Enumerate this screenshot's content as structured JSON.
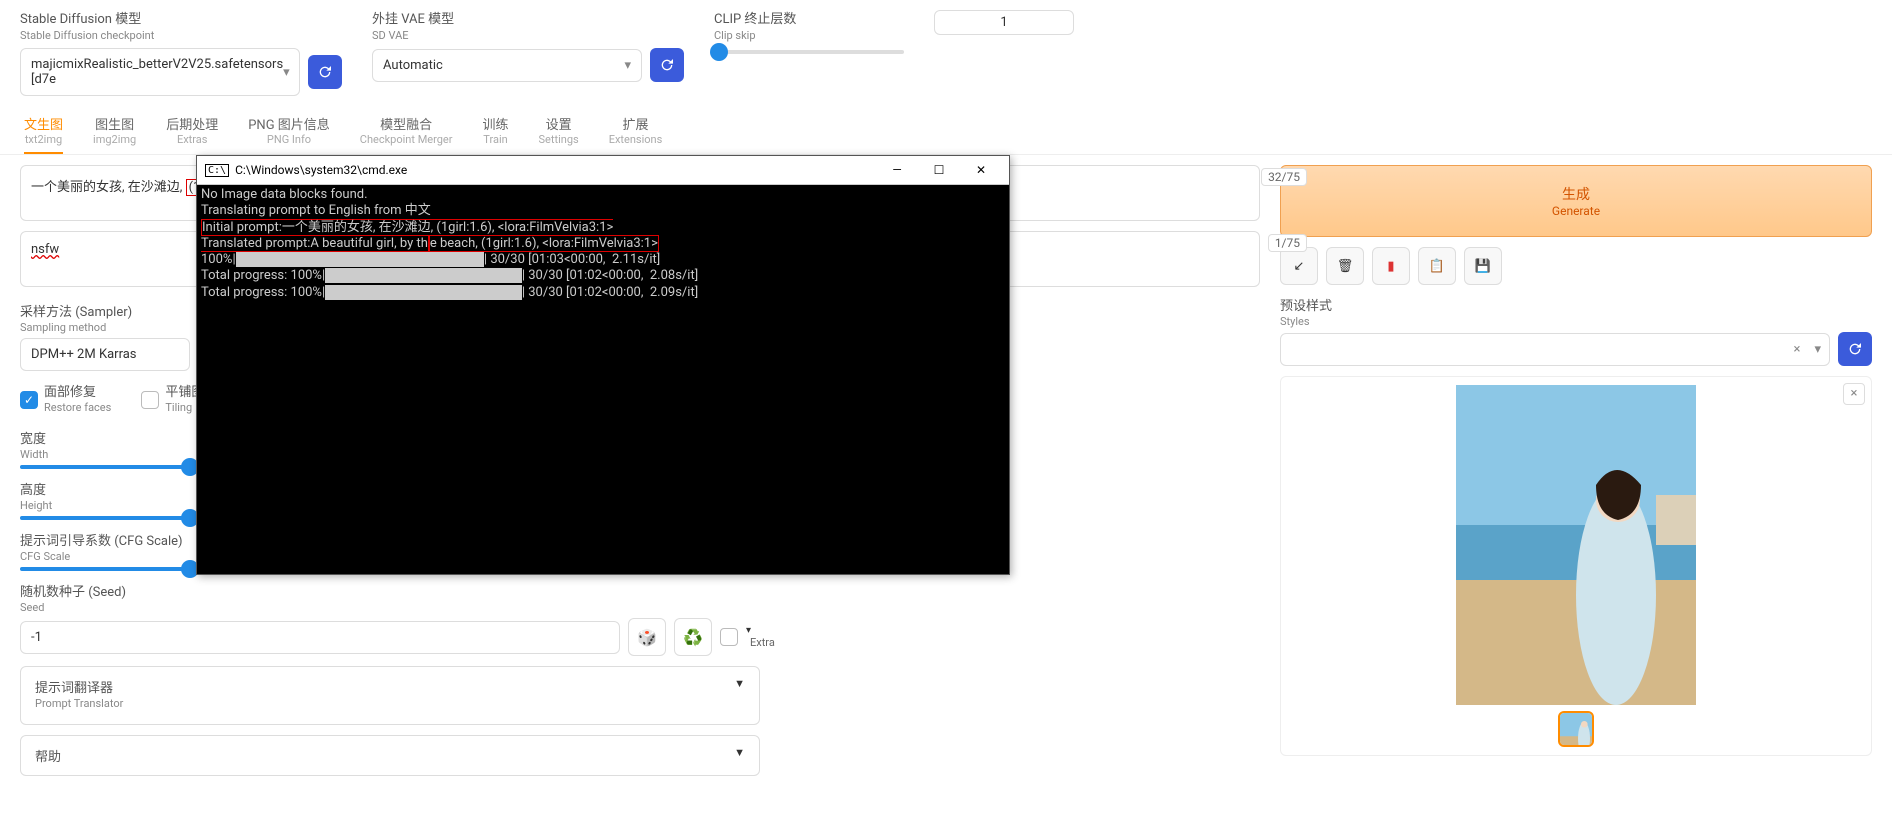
{
  "top": {
    "sd_checkpoint_cn": "Stable Diffusion 模型",
    "sd_checkpoint_en": "Stable Diffusion checkpoint",
    "sd_value": "majicmixRealistic_betterV2V25.safetensors [d7e",
    "vae_cn": "外挂 VAE 模型",
    "vae_en": "SD VAE",
    "vae_value": "Automatic",
    "clip_cn": "CLIP 终止层数",
    "clip_en": "Clip skip",
    "clip_value": "1"
  },
  "tabs": [
    {
      "cn": "文生图",
      "en": "txt2img"
    },
    {
      "cn": "图生图",
      "en": "img2img"
    },
    {
      "cn": "后期处理",
      "en": "Extras"
    },
    {
      "cn": "PNG 图片信息",
      "en": "PNG Info"
    },
    {
      "cn": "模型融合",
      "en": "Checkpoint Merger"
    },
    {
      "cn": "训练",
      "en": "Train"
    },
    {
      "cn": "设置",
      "en": "Settings"
    },
    {
      "cn": "扩展",
      "en": "Extensions"
    }
  ],
  "prompt": {
    "prefix": "一个美丽的女孩, 在沙滩边,",
    "highlight": "(1girl:1.6), <lora:FilmVelvia3:1>",
    "token": "32/75"
  },
  "neg": {
    "text": "nsfw",
    "token": "1/75"
  },
  "params": {
    "sampler_cn": "采样方法 (Sampler)",
    "sampler_en": "Sampling method",
    "sampler_value": "DPM++ 2M Karras",
    "restore_cn": "面部修复",
    "restore_en": "Restore faces",
    "tiling_cn": "平铺图 (Tili",
    "tiling_en": "Tiling",
    "width_cn": "宽度",
    "width_en": "Width",
    "height_cn": "高度",
    "height_en": "Height",
    "cfg_cn": "提示词引导系数 (CFG Scale)",
    "cfg_en": "CFG Scale",
    "seed_cn": "随机数种子 (Seed)",
    "seed_en": "Seed",
    "seed_value": "-1",
    "extra": "Extra",
    "acc1_cn": "提示词翻译器",
    "acc1_en": "Prompt Translator",
    "acc2_cn": "帮助"
  },
  "gen": {
    "cn": "生成",
    "en": "Generate"
  },
  "styles": {
    "cn": "预设样式",
    "en": "Styles"
  },
  "cmd": {
    "title": "C:\\Windows\\system32\\cmd.exe",
    "l1": "No Image data blocks found.",
    "l2": "Translating prompt to English from 中文",
    "l3a": "Initial prompt:一个美丽的女孩, 在沙滩边,",
    "l3b": " (1girl:1.6), <lora:FilmVelvia3:1>",
    "l4a": "Translated prompt:A beautiful girl, by th",
    "l4b": "e beach, (1girl:1.6), <lora:FilmVelvia3:1>",
    "l5a": "100%|",
    "l5b": "                                                                             ",
    "l5c": "| 30/30 [01:03<00:00,  2.11s/it]",
    "l6a": "Total progress: 100%|",
    "l6b": "                                                             ",
    "l6c": "| 30/30 [01:02<00:00,  2.08s/it]",
    "l7a": "Total progress: 100%|",
    "l7b": "                                                             ",
    "l7c": "| 30/30 [01:02<00:00,  2.09s/it]"
  }
}
